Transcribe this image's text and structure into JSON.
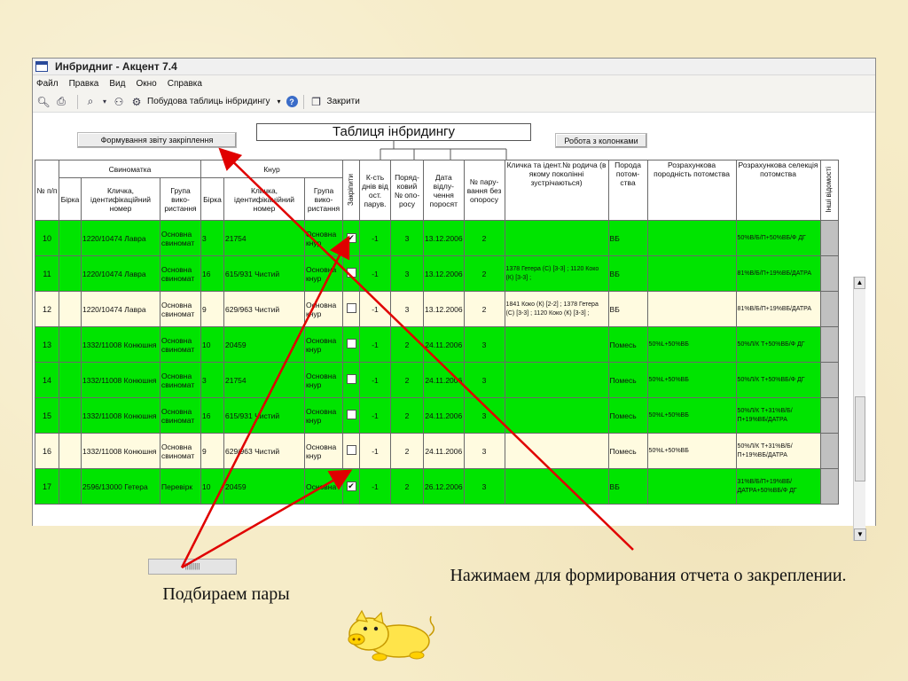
{
  "window": {
    "title": "Инбридниг - Акцент 7.4",
    "menu": [
      "Файл",
      "Правка",
      "Вид",
      "Окно",
      "Справка"
    ],
    "toolbar": {
      "build_label": "Побудова таблиць інбридингу",
      "close_label": "Закрити"
    }
  },
  "buttons": {
    "report": "Формування звіту закріплення",
    "columns": "Робота з колонками"
  },
  "table_title": "Таблиця інбридингу",
  "headers": {
    "num": "№ п/п",
    "sow": "Свиноматка",
    "boar": "Кнур",
    "tag": "Бірка",
    "name_id": "Кличка, ідентифікаційний номер",
    "use_group": "Група вико-ристання",
    "fix": "Закріпити",
    "days": "К-сть днів від ост. парув.",
    "order": "Поряд-ковий № опо-росу",
    "date": "Дата відлу-чення поросят",
    "pairs": "№ пару-вання без опоросу",
    "ancestor": "Кличка та ідент.№ родича (в якому поколінні зустрічаються)",
    "breed": "Порода потом-ства",
    "calc_breed": "Розрахункова породність потомства",
    "calc_sel": "Розрахункова селекція потомства",
    "other": "Інші відомості"
  },
  "rows": [
    {
      "n": "10",
      "tag": "",
      "sow": "1220/10474 Лавра",
      "sg": "Основна свиномат",
      "bt": "3",
      "boar": "21754",
      "bg": "Основна кнур",
      "chk": "✔",
      "days": "-1",
      "order": "3",
      "date": "13.12.2006",
      "pairs": "2",
      "anc": "",
      "breed": "ВБ",
      "cb": "",
      "cs": "50%В/Б/П+50%ВБ/Ф ДГ",
      "color": "g"
    },
    {
      "n": "11",
      "tag": "",
      "sow": "1220/10474 Лавра",
      "sg": "Основна свиномат",
      "bt": "16",
      "boar": "615/931 Чистий",
      "bg": "Основна кнур",
      "chk": "",
      "days": "-1",
      "order": "3",
      "date": "13.12.2006",
      "pairs": "2",
      "anc": "1378 Гетера (С) [3-3] ; 1120 Коко (К) [3-3] ;",
      "breed": "ВБ",
      "cb": "",
      "cs": "81%В/Б/П+19%ВБ/ДАТРА",
      "color": "g"
    },
    {
      "n": "12",
      "tag": "",
      "sow": "1220/10474 Лавра",
      "sg": "Основна свиномат",
      "bt": "9",
      "boar": "629/963 Чистий",
      "bg": "Основна кнур",
      "chk": "",
      "days": "-1",
      "order": "3",
      "date": "13.12.2006",
      "pairs": "2",
      "anc": "1841 Коко (К) [2-2] ; 1378 Гетера (С) [3-3] ; 1120 Коко (К) [3-3] ;",
      "breed": "ВБ",
      "cb": "",
      "cs": "81%В/Б/П+19%ВБ/ДАТРА",
      "color": "y"
    },
    {
      "n": "13",
      "tag": "",
      "sow": "1332/11008 Конюшня",
      "sg": "Основна свиномат",
      "bt": "10",
      "boar": "20459",
      "bg": "Основна кнур",
      "chk": "",
      "days": "-1",
      "order": "2",
      "date": "24.11.2006",
      "pairs": "3",
      "anc": "",
      "breed": "Помесь",
      "cb": "50%L+50%ВБ",
      "cs": "50%Л/К Т+50%ВБ/Ф ДГ",
      "color": "g"
    },
    {
      "n": "14",
      "tag": "",
      "sow": "1332/11008 Конюшня",
      "sg": "Основна свиномат",
      "bt": "3",
      "boar": "21754",
      "bg": "Основна кнур",
      "chk": "",
      "days": "-1",
      "order": "2",
      "date": "24.11.2006",
      "pairs": "3",
      "anc": "",
      "breed": "Помесь",
      "cb": "50%L+50%ВБ",
      "cs": "50%Л/К Т+50%ВБ/Ф ДГ",
      "color": "g"
    },
    {
      "n": "15",
      "tag": "",
      "sow": "1332/11008 Конюшня",
      "sg": "Основна свиномат",
      "bt": "16",
      "boar": "615/931 Чистий",
      "bg": "Основна кнур",
      "chk": "",
      "days": "-1",
      "order": "2",
      "date": "24.11.2006",
      "pairs": "3",
      "anc": "",
      "breed": "Помесь",
      "cb": "50%L+50%ВБ",
      "cs": "50%Л/К Т+31%В/Б/П+19%ВБ/ДАТРА",
      "color": "g"
    },
    {
      "n": "16",
      "tag": "",
      "sow": "1332/11008 Конюшня",
      "sg": "Основна свиномат",
      "bt": "9",
      "boar": "629/963 Чистий",
      "bg": "Основна кнур",
      "chk": "",
      "days": "-1",
      "order": "2",
      "date": "24.11.2006",
      "pairs": "3",
      "anc": "",
      "breed": "Помесь",
      "cb": "50%L+50%ВБ",
      "cs": "50%Л/К Т+31%В/Б/П+19%ВБ/ДАТРА",
      "color": "y"
    },
    {
      "n": "17",
      "tag": "",
      "sow": "2596/13000 Гетера",
      "sg": "Перевірк",
      "bt": "10",
      "boar": "20459",
      "bg": "Основна",
      "chk": "✔",
      "days": "-1",
      "order": "2",
      "date": "26.12.2006",
      "pairs": "3",
      "anc": "",
      "breed": "ВБ",
      "cb": "",
      "cs": "31%В/Б/П+19%ВБ/ДАТРА+50%ВБ/Ф ДГ",
      "color": "g"
    }
  ],
  "captions": {
    "left": "Подбираем пары",
    "right": "Нажимаем для формирования отчета о закреплении."
  },
  "colors": {
    "row_green": "#00e400",
    "row_light": "#fffbe0",
    "arrow": "#e00000"
  }
}
